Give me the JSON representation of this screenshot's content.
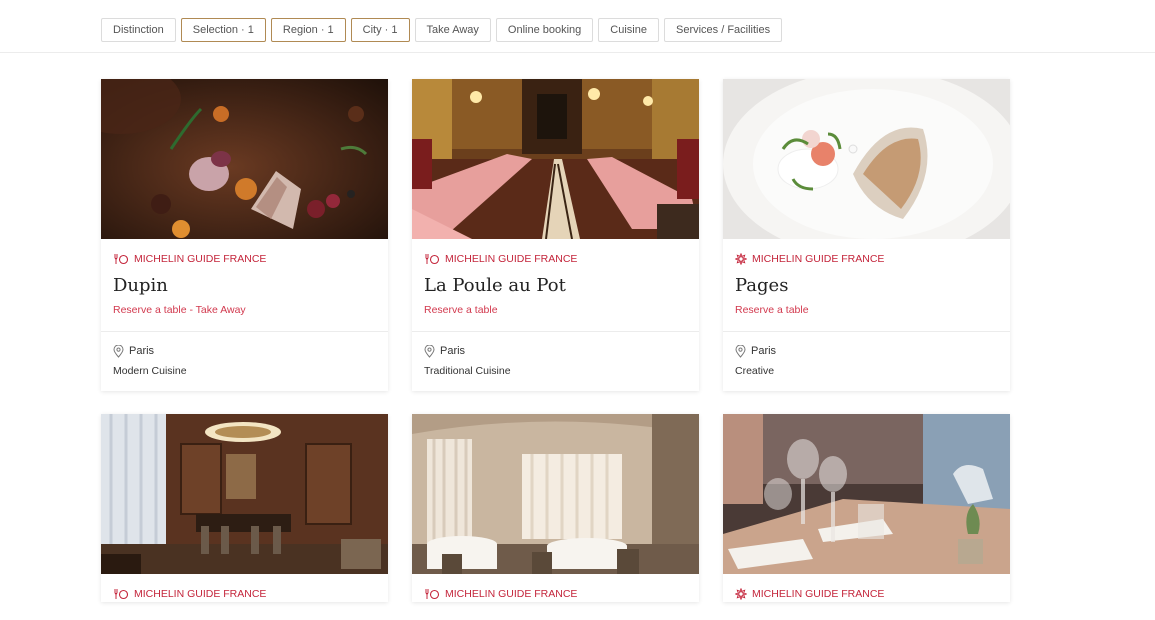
{
  "filters": [
    {
      "label": "Distinction",
      "active": false
    },
    {
      "label": "Selection · 1",
      "active": true
    },
    {
      "label": "Region · 1",
      "active": true
    },
    {
      "label": "City · 1",
      "active": true
    },
    {
      "label": "Take Away",
      "active": false
    },
    {
      "label": "Online booking",
      "active": false
    },
    {
      "label": "Cuisine",
      "active": false
    },
    {
      "label": "Services / Facilities",
      "active": false
    }
  ],
  "cards": [
    {
      "guide": "MICHELIN GUIDE FRANCE",
      "guide_icon": "bib-gourmand-icon",
      "name": "Dupin",
      "booking": "Reserve a table - Take Away",
      "city": "Paris",
      "cuisine": "Modern Cuisine",
      "photo": "plated-dish-photo"
    },
    {
      "guide": "MICHELIN GUIDE FRANCE",
      "guide_icon": "bib-gourmand-icon",
      "name": "La Poule au Pot",
      "booking": "Reserve a table",
      "city": "Paris",
      "cuisine": "Traditional Cuisine",
      "photo": "dining-room-photo"
    },
    {
      "guide": "MICHELIN GUIDE FRANCE",
      "guide_icon": "michelin-plate-icon",
      "name": "Pages",
      "booking": "Reserve a table",
      "city": "Paris",
      "cuisine": "Creative",
      "photo": "white-plate-dish-photo"
    },
    {
      "guide": "MICHELIN GUIDE FRANCE",
      "guide_icon": "bib-gourmand-icon",
      "photo": "wood-paneled-room-photo"
    },
    {
      "guide": "MICHELIN GUIDE FRANCE",
      "guide_icon": "bib-gourmand-icon",
      "photo": "white-dining-room-photo"
    },
    {
      "guide": "MICHELIN GUIDE FRANCE",
      "guide_icon": "michelin-plate-icon",
      "photo": "wine-glasses-table-photo"
    }
  ],
  "colors": {
    "accent": "#c4253b",
    "booking": "#d2394e",
    "chip_active_border": "#b08a53"
  }
}
